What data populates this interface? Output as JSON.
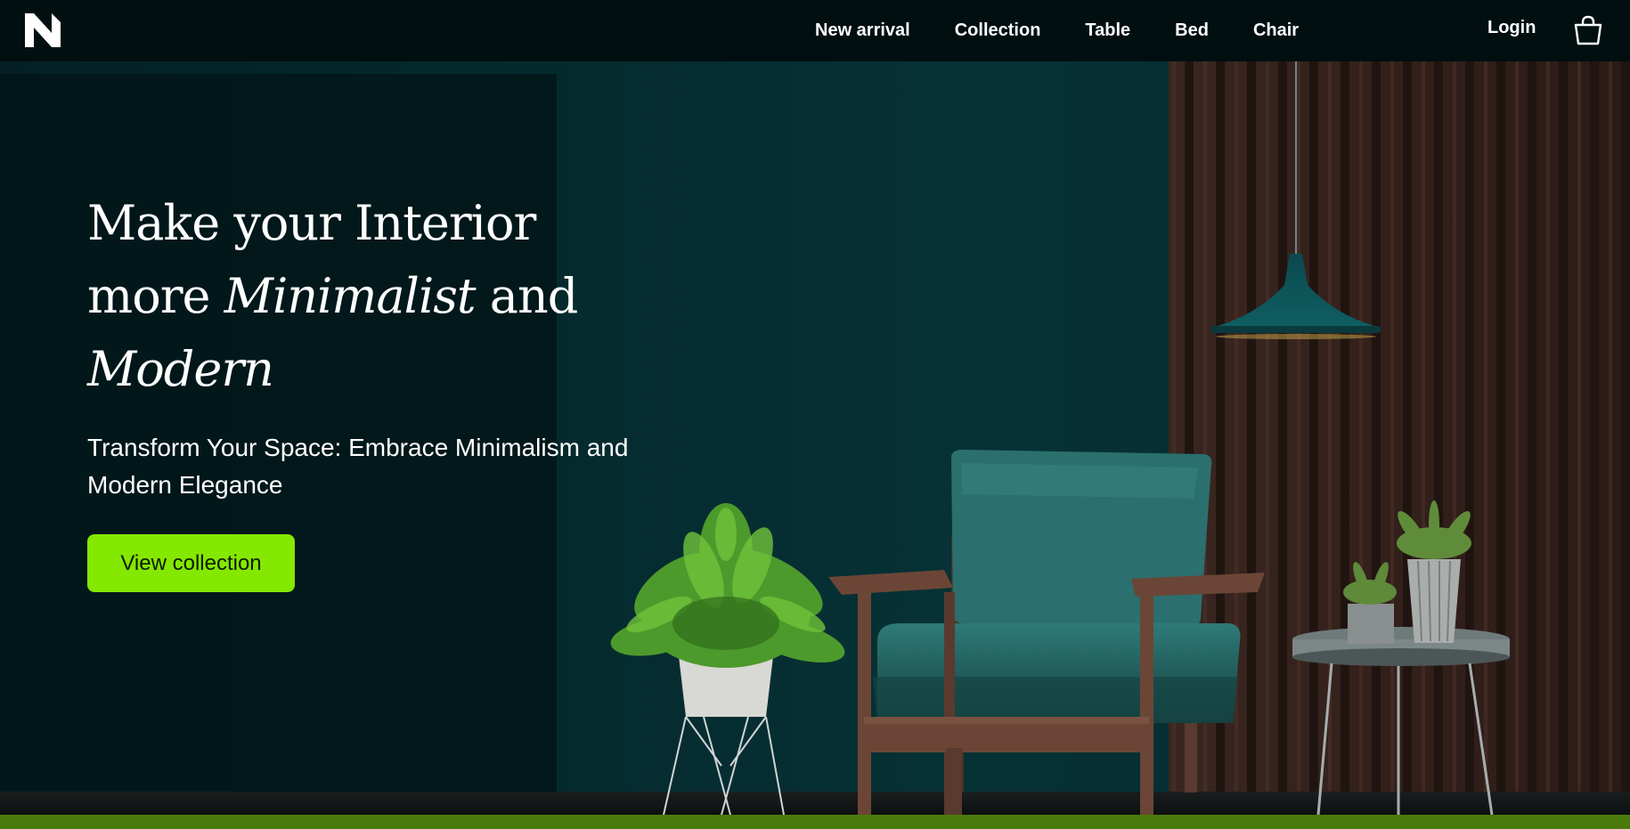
{
  "nav": {
    "logo_icon": "brand-n-logo",
    "links": [
      "New arrival",
      "Collection",
      "Table",
      "Bed",
      "Chair"
    ],
    "login_label": "Login",
    "cart_icon": "shopping-bag-icon"
  },
  "hero": {
    "headline_line1": "Make your Interior",
    "headline_line2_a": "more ",
    "headline_line2_b": "Minimalist",
    "headline_line2_c": " and",
    "headline_line3": "Modern",
    "subheadline": "Transform Your Space: Embrace Minimalism and Modern Elegance",
    "cta_label": "View collection"
  },
  "colors": {
    "accent": "#84e800",
    "nav_background": "#010f10",
    "hero_background": "#052b2e",
    "footer_strip": "#4b7a0c"
  }
}
